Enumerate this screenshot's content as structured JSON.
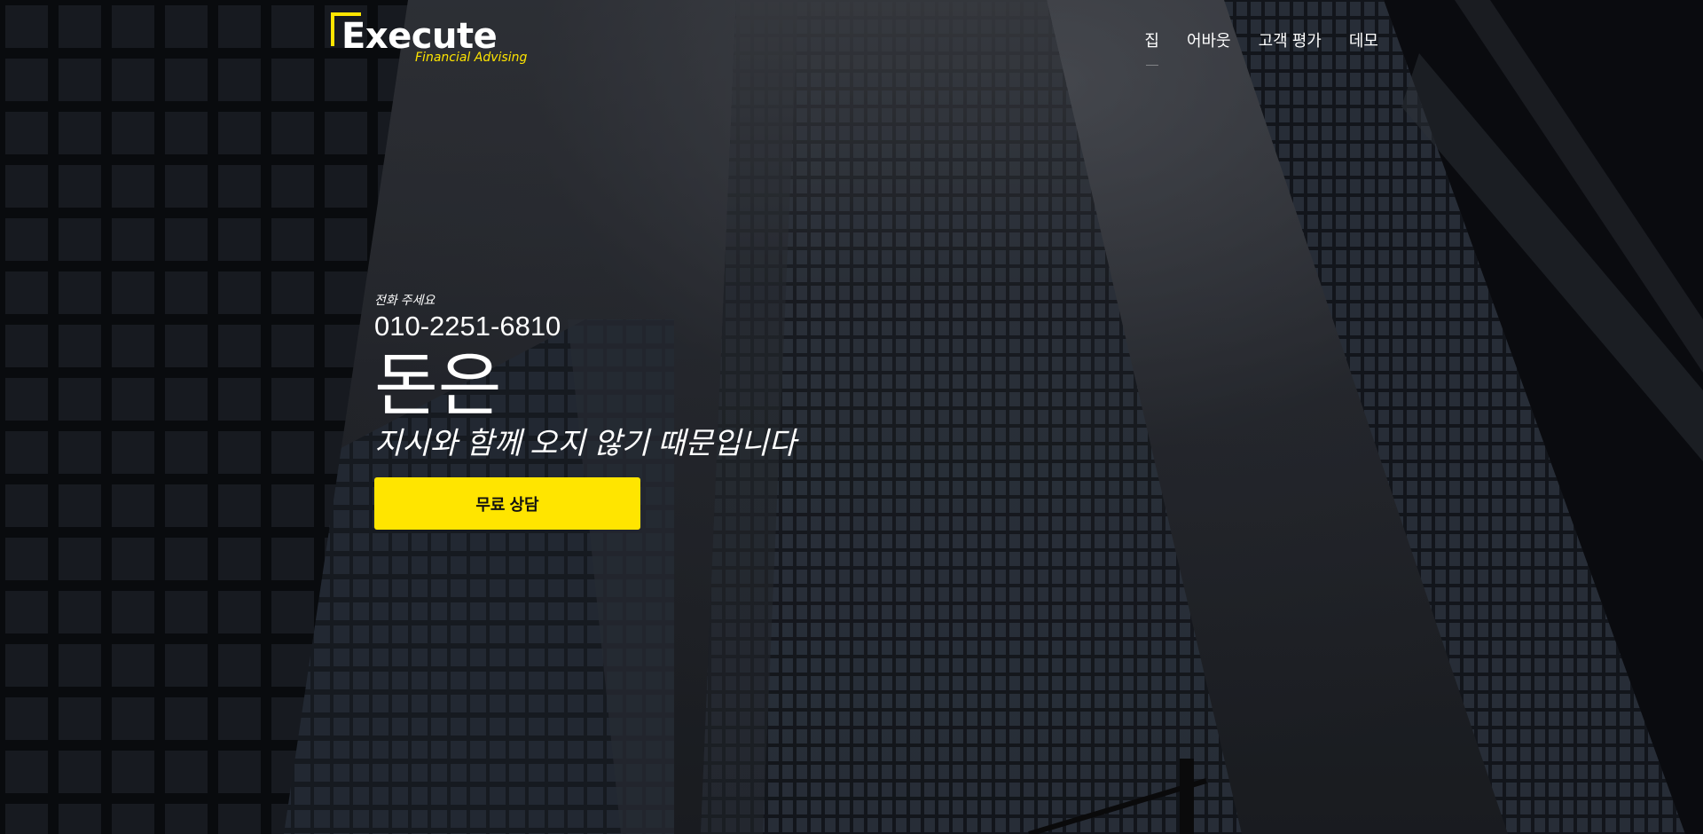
{
  "brand": {
    "name": "Execute",
    "tagline": "Financial Advising"
  },
  "nav": {
    "items": [
      {
        "label": "집"
      },
      {
        "label": "어바웃"
      },
      {
        "label": "고객 평가"
      },
      {
        "label": "데모"
      }
    ]
  },
  "hero": {
    "call_label": "전화 주세요",
    "phone": "010-2251-6810",
    "headline": "돈은",
    "tagline": "지시와 함께 오지 않기 때문입니다",
    "cta_label": "무료 상담"
  },
  "colors": {
    "accent": "#ffe500",
    "text": "#ffffff",
    "button_text": "#111111"
  }
}
